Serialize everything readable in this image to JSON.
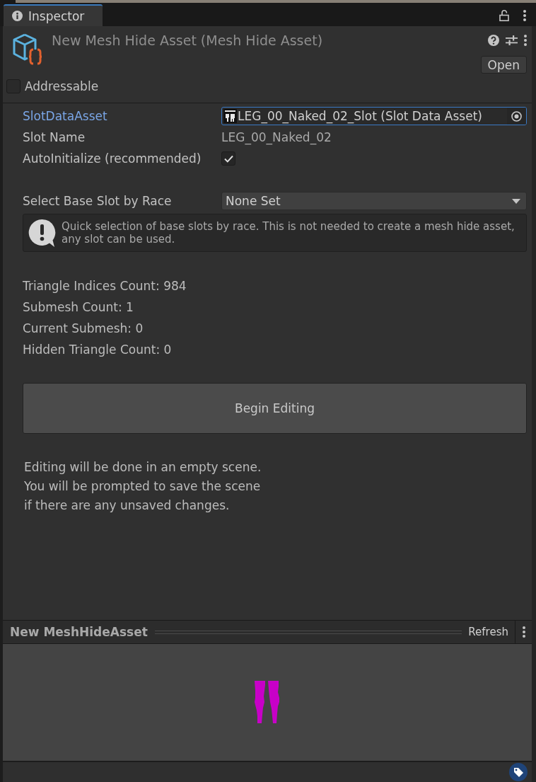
{
  "tabs": [
    {
      "label": "Inspector",
      "selected": true
    }
  ],
  "header": {
    "title": "New Mesh Hide Asset (Mesh Hide Asset)",
    "open_button": "Open"
  },
  "addressable": {
    "label": "Addressable",
    "checked": false
  },
  "fields": [
    {
      "kind": "object",
      "label": "SlotDataAsset",
      "value": "LEG_00_Naked_02_Slot (Slot Data Asset)",
      "focused": true
    },
    {
      "kind": "text",
      "label": "Slot Name",
      "value": "LEG_00_Naked_02"
    },
    {
      "kind": "checkbox",
      "label": "AutoInitialize (recommended)",
      "checked": true
    }
  ],
  "race_select": {
    "label": "Select Base Slot by Race",
    "value": "None Set"
  },
  "help_box": {
    "text": "Quick selection of base slots by race. This is not needed to create a mesh hide asset, any slot can be used."
  },
  "stats": [
    "Triangle Indices Count: 984",
    "Submesh Count: 1",
    "Current Submesh: 0",
    "Hidden Triangle Count: 0"
  ],
  "begin_button": "Begin Editing",
  "note": "Editing will be done in an empty scene.\nYou will be prompted to save the scene\nif there are any unsaved changes.",
  "preview": {
    "title": "New MeshHideAsset",
    "refresh_button": "Refresh"
  }
}
